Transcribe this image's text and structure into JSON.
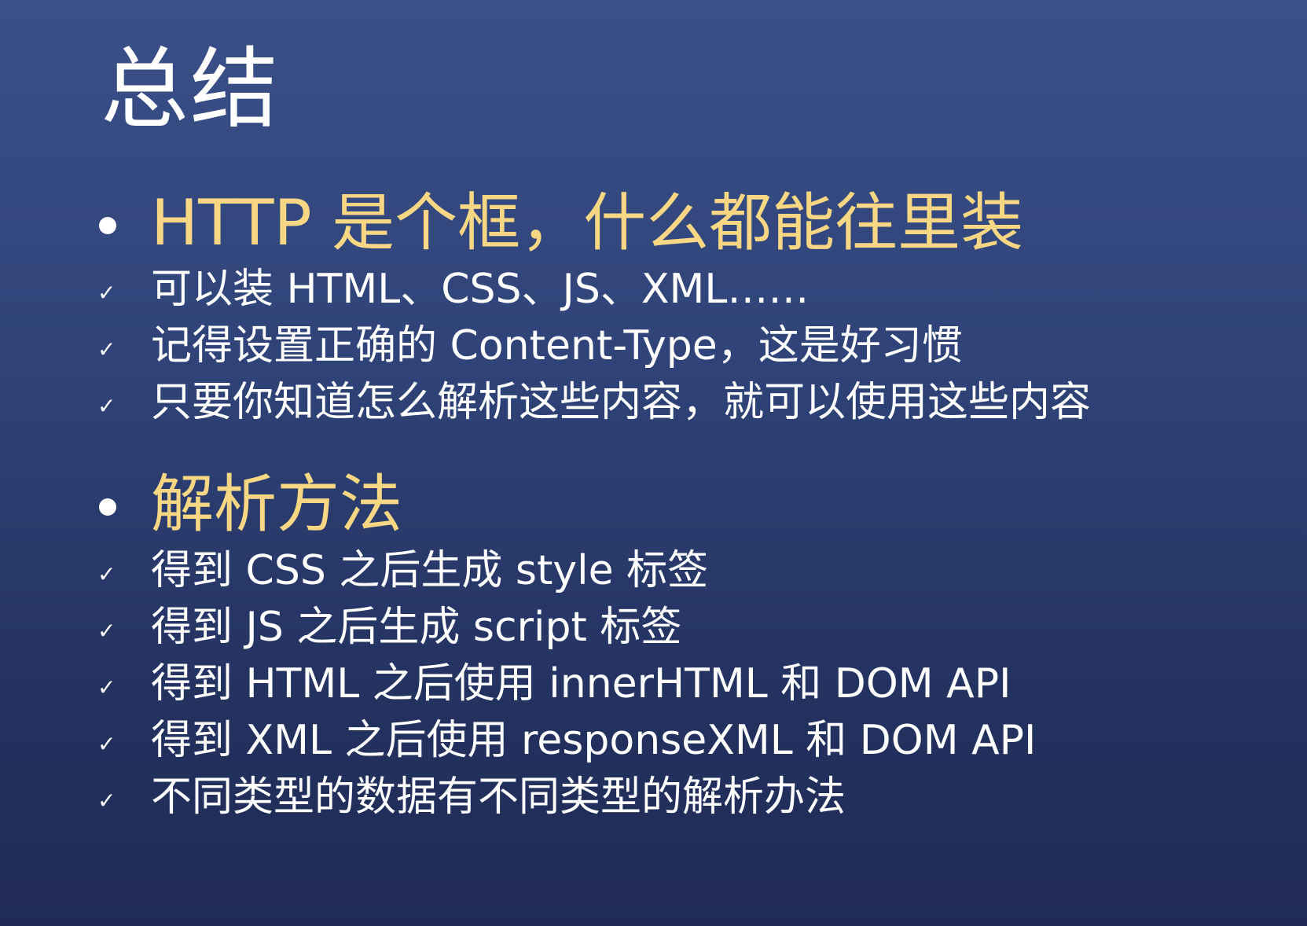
{
  "title": "总结",
  "sections": [
    {
      "heading": "HTTP 是个框，什么都能往里装",
      "items": [
        "可以装 HTML、CSS、JS、XML……",
        "记得设置正确的 Content-Type，这是好习惯",
        "只要你知道怎么解析这些内容，就可以使用这些内容"
      ]
    },
    {
      "heading": "解析方法",
      "items": [
        "得到 CSS 之后生成 style 标签",
        "得到 JS 之后生成 script 标签",
        "得到 HTML 之后使用 innerHTML 和 DOM API",
        "得到 XML 之后使用 responseXML 和 DOM API",
        "不同类型的数据有不同类型的解析办法"
      ]
    }
  ],
  "icons": {
    "bullet": "bullet-dot-icon",
    "check": "check-icon"
  },
  "colors": {
    "background_top": "#3a5088",
    "background_bottom": "#1f2b55",
    "heading": "#f7d784",
    "text": "#ffffff"
  }
}
